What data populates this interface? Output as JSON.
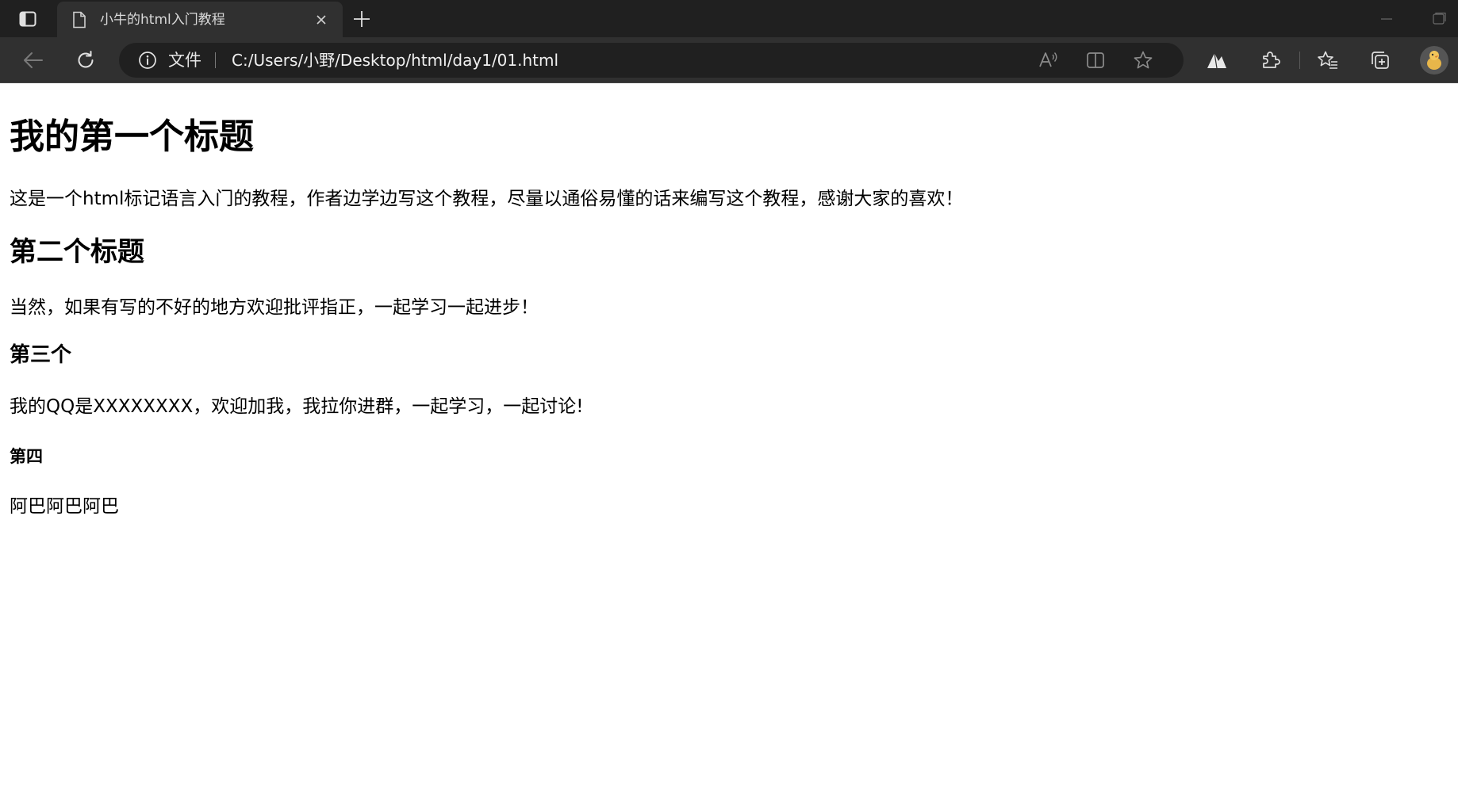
{
  "tab": {
    "title": "小牛的html入门教程"
  },
  "address_bar": {
    "site_label": "文件",
    "url": "C:/Users/小野/Desktop/html/day1/01.html"
  },
  "icons": {
    "tab_actions": "tab-actions-icon",
    "page": "page-icon",
    "close": "close-icon",
    "new_tab": "plus-icon",
    "back": "back-arrow-icon",
    "refresh": "refresh-icon",
    "site_info": "info-icon",
    "read_aloud": "read-aloud-icon",
    "split_screen": "split-screen-icon",
    "favorite": "star-icon",
    "extension_a": "triangle-extension-icon",
    "extensions": "puzzle-icon",
    "favorites": "favorites-icon",
    "collections": "collections-icon",
    "profile": "avatar-icon"
  },
  "colors": {
    "tabstrip_bg": "#202020",
    "toolbar_bg": "#303030",
    "addressbar_bg": "#202020",
    "page_bg": "#ffffff",
    "text": "#000000"
  },
  "page": {
    "h1": "我的第一个标题",
    "p1": "这是一个html标记语言入门的教程，作者边学边写这个教程，尽量以通俗易懂的话来编写这个教程，感谢大家的喜欢！",
    "h2": "第二个标题",
    "p2": "当然，如果有写的不好的地方欢迎批评指正，一起学习一起进步！",
    "h3": "第三个",
    "p3": "我的QQ是XXXXXXXX，欢迎加我，我拉你进群，一起学习，一起讨论!",
    "h4": "第四",
    "p4": "阿巴阿巴阿巴"
  }
}
